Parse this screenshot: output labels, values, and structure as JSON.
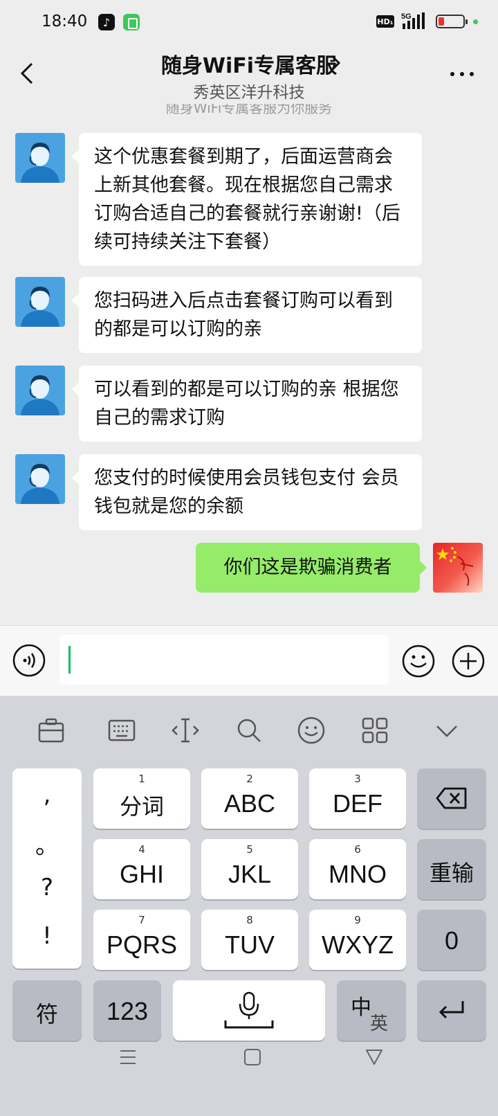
{
  "status_bar": {
    "time": "18:40",
    "tiktok_glyph": "♪",
    "hd_label": "HD₁",
    "network_label": "5G"
  },
  "header": {
    "title": "随身WiFi专属客服",
    "subtitle": "秀英区洋升科技"
  },
  "chat": {
    "system_note": "随身WiFi专属客服为你服务",
    "messages": [
      {
        "sender": "agent",
        "text": "这个优惠套餐到期了，后面运营商会上新其他套餐。现在根据您自己需求订购合适自己的套餐就行亲谢谢!（后续可持续关注下套餐）"
      },
      {
        "sender": "agent",
        "text": "您扫码进入后点击套餐订购可以看到的都是可以订购的亲"
      },
      {
        "sender": "agent",
        "text": "可以看到的都是可以订购的亲 根据您自己的需求订购"
      },
      {
        "sender": "agent",
        "text": "您支付的时候使用会员钱包支付 会员钱包就是您的余额"
      },
      {
        "sender": "me",
        "text": "你们这是欺骗消费者"
      }
    ]
  },
  "input": {
    "value": ""
  },
  "keyboard": {
    "punctuation": [
      ",",
      "。",
      "?",
      "!"
    ],
    "keys": [
      {
        "num": "1",
        "label": "分词"
      },
      {
        "num": "2",
        "label": "ABC"
      },
      {
        "num": "3",
        "label": "DEF"
      },
      {
        "num": "4",
        "label": "GHI"
      },
      {
        "num": "5",
        "label": "JKL"
      },
      {
        "num": "6",
        "label": "MNO"
      },
      {
        "num": "7",
        "label": "PQRS"
      },
      {
        "num": "8",
        "label": "TUV"
      },
      {
        "num": "9",
        "label": "WXYZ"
      }
    ],
    "reinput_label": "重输",
    "zero_label": "0",
    "symbol_label": "符",
    "numbers_label": "123",
    "lang_zh": "中",
    "lang_en": "英"
  },
  "colors": {
    "my_bubble": "#95ec69",
    "agent_avatar": "#4aa3e0",
    "cursor": "#07c160"
  }
}
